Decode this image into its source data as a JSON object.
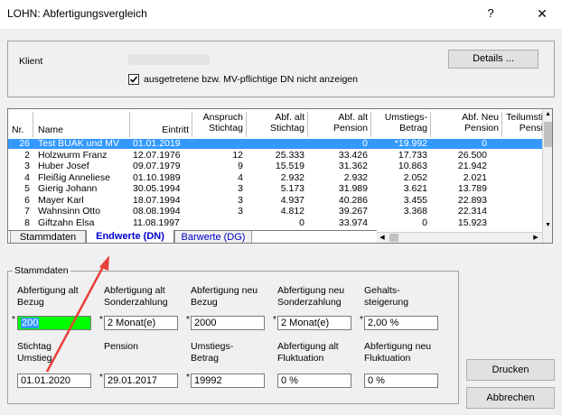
{
  "window": {
    "title": "LOHN: Abfertigungsvergleich",
    "help_glyph": "?",
    "close_glyph": "✕"
  },
  "client": {
    "label": "Klient",
    "name": "",
    "details_label": "Details ...",
    "checkbox_checked": true,
    "checkbox_label": "ausgetretene bzw. MV-pflichtige DN nicht anzeigen"
  },
  "grid": {
    "headers": {
      "nr": "Nr.",
      "name": "Name",
      "eintritt": "Eintritt",
      "anspruch_1": "Anspruch",
      "anspruch_2": "Stichtag",
      "abf_alt_1": "Abf. alt",
      "abf_alt_2": "Stichtag",
      "abf_alt_pension_1": "Abf. alt",
      "abf_alt_pension_2": "Pension",
      "umstieg_1": "Umstiegs-",
      "umstieg_2": "Betrag",
      "abf_neu_1": "Abf. Neu",
      "abf_neu_2": "Pension",
      "teil_1": "Teilumsti",
      "teil_2": "Pensi"
    },
    "rows": [
      {
        "nr": "26",
        "name": "Test BUAK und MV",
        "eintritt": "01.01.2019",
        "anspruch": "",
        "abf_alt": "",
        "abf_alt_pension": "0",
        "umstieg": "*19.992",
        "abf_neu": "0",
        "selected": true
      },
      {
        "nr": "2",
        "name": "Holzwurm Franz",
        "eintritt": "12.07.1976",
        "anspruch": "12",
        "abf_alt": "25.333",
        "abf_alt_pension": "33.426",
        "umstieg": "17.733",
        "abf_neu": "26.500",
        "selected": false
      },
      {
        "nr": "3",
        "name": "Huber Josef",
        "eintritt": "09.07.1979",
        "anspruch": "9",
        "abf_alt": "15.519",
        "abf_alt_pension": "31.362",
        "umstieg": "10.863",
        "abf_neu": "21.942",
        "selected": false
      },
      {
        "nr": "4",
        "name": "Fleißig Anneliese",
        "eintritt": "01.10.1989",
        "anspruch": "4",
        "abf_alt": "2.932",
        "abf_alt_pension": "2.932",
        "umstieg": "2.052",
        "abf_neu": "2.021",
        "selected": false
      },
      {
        "nr": "5",
        "name": "Gierig Johann",
        "eintritt": "30.05.1994",
        "anspruch": "3",
        "abf_alt": "5.173",
        "abf_alt_pension": "31.989",
        "umstieg": "3.621",
        "abf_neu": "13.789",
        "selected": false
      },
      {
        "nr": "6",
        "name": "Mayer Karl",
        "eintritt": "18.07.1994",
        "anspruch": "3",
        "abf_alt": "4.937",
        "abf_alt_pension": "40.286",
        "umstieg": "3.455",
        "abf_neu": "22.893",
        "selected": false
      },
      {
        "nr": "7",
        "name": "Wahnsinn Otto",
        "eintritt": "08.08.1994",
        "anspruch": "3",
        "abf_alt": "4.812",
        "abf_alt_pension": "39.267",
        "umstieg": "3.368",
        "abf_neu": "22.314",
        "selected": false
      },
      {
        "nr": "8",
        "name": "Giftzahn Elsa",
        "eintritt": "11.08.1997",
        "anspruch": "",
        "abf_alt": "0",
        "abf_alt_pension": "33.974",
        "umstieg": "0",
        "abf_neu": "15.923",
        "selected": false
      }
    ]
  },
  "tabs": {
    "stammdaten": "Stammdaten",
    "endwerte": "Endwerte (DN)",
    "barwerte": "Barwerte (DG)"
  },
  "stammdaten": {
    "group_label": "Stammdaten",
    "abf_alt_bezug_label_1": "Abfertigung alt",
    "abf_alt_bezug_label_2": "Bezug",
    "abf_alt_bezug_value": "200",
    "abf_alt_sonder_label_1": "Abfertigung alt",
    "abf_alt_sonder_label_2": "Sonderzahlung",
    "abf_alt_sonder_value": "2  Monat(e)",
    "abf_neu_bezug_label_1": "Abfertigung neu",
    "abf_neu_bezug_label_2": "Bezug",
    "abf_neu_bezug_value": "2000",
    "abf_neu_sonder_label_1": "Abfertigung neu",
    "abf_neu_sonder_label_2": "Sonderzahlung",
    "abf_neu_sonder_value": "2  Monat(e)",
    "gehalt_label_1": "Gehalts-",
    "gehalt_label_2": "steigerung",
    "gehalt_value": "2,00  %",
    "stichtag_label_1": "Stichtag",
    "stichtag_label_2": "Umstieg",
    "stichtag_value": "01.01.2020",
    "pension_label": "Pension",
    "pension_value": "29.01.2017",
    "umstieg_label_1": "Umstiegs-",
    "umstieg_label_2": "Betrag",
    "umstieg_value": "19992",
    "fluk_alt_label_1": "Abfertigung alt",
    "fluk_alt_label_2": "Fluktuation",
    "fluk_alt_value": "0  %",
    "fluk_neu_label_1": "Abfertigung neu",
    "fluk_neu_label_2": "Fluktuation",
    "fluk_neu_value": "0  %",
    "star": "*"
  },
  "buttons": {
    "print": "Drucken",
    "cancel": "Abbrechen"
  },
  "colors": {
    "selection": "#3399ff",
    "highlight_field": "#00ff00",
    "active_tab_text": "#0000cc",
    "arrow": "#e8403a"
  }
}
